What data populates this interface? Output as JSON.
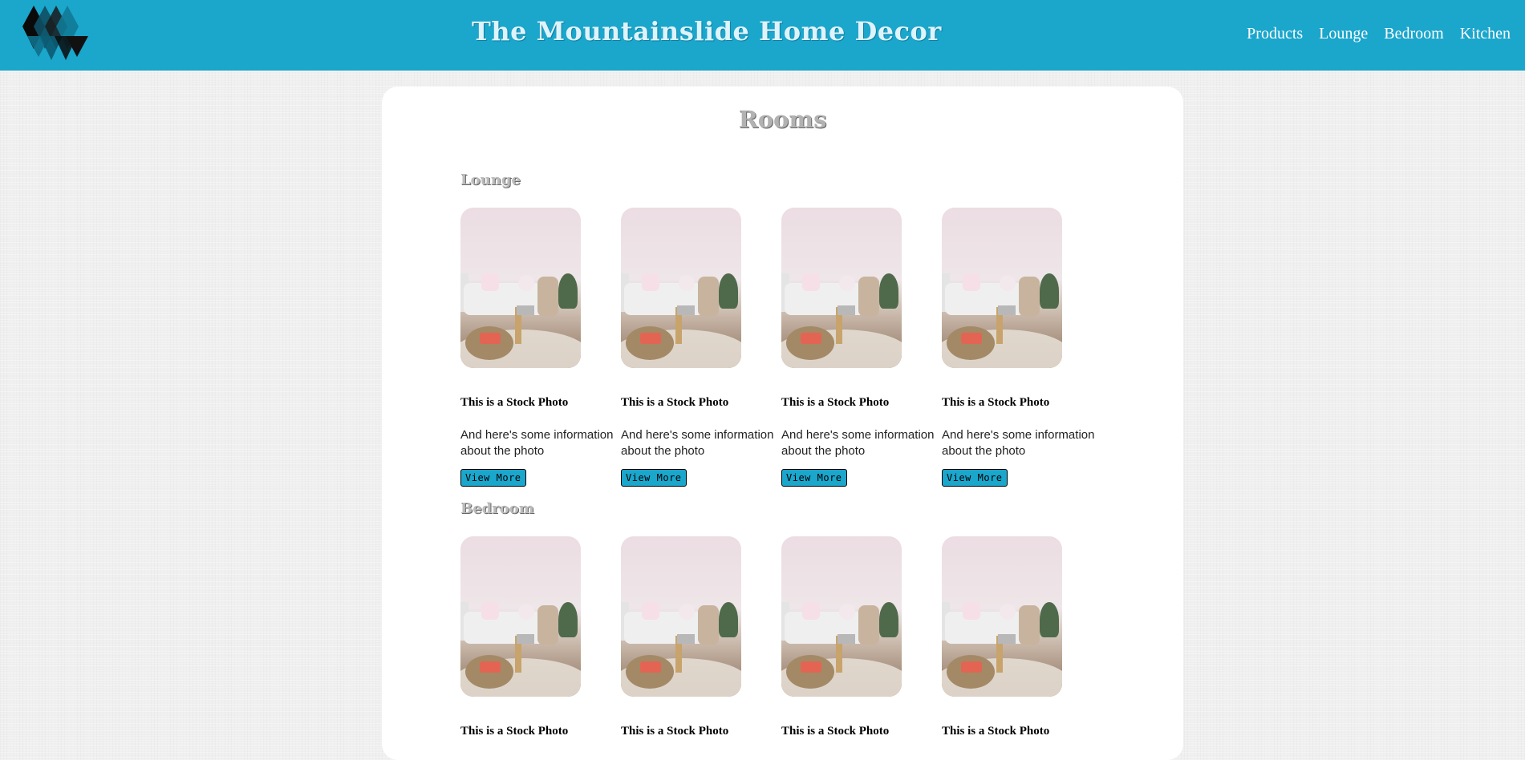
{
  "header": {
    "site_title": "The Mountainslide Home Decor",
    "nav": [
      "Products",
      "Lounge",
      "Bedroom",
      "Kitchen"
    ]
  },
  "colors": {
    "header_bg": "#1ba6cc",
    "button_bg": "#1ba6cc"
  },
  "main": {
    "title": "Rooms",
    "sections": [
      {
        "name": "Lounge",
        "cards": [
          {
            "title": "This is a Stock Photo",
            "description": "And here's some information about the photo",
            "button": "View More"
          },
          {
            "title": "This is a Stock Photo",
            "description": "And here's some information about the photo",
            "button": "View More"
          },
          {
            "title": "This is a Stock Photo",
            "description": "And here's some information about the photo",
            "button": "View More"
          },
          {
            "title": "This is a Stock Photo",
            "description": "And here's some information about the photo",
            "button": "View More"
          }
        ]
      },
      {
        "name": "Bedroom",
        "cards": [
          {
            "title": "This is a Stock Photo"
          },
          {
            "title": "This is a Stock Photo"
          },
          {
            "title": "This is a Stock Photo"
          },
          {
            "title": "This is a Stock Photo"
          }
        ]
      }
    ]
  }
}
